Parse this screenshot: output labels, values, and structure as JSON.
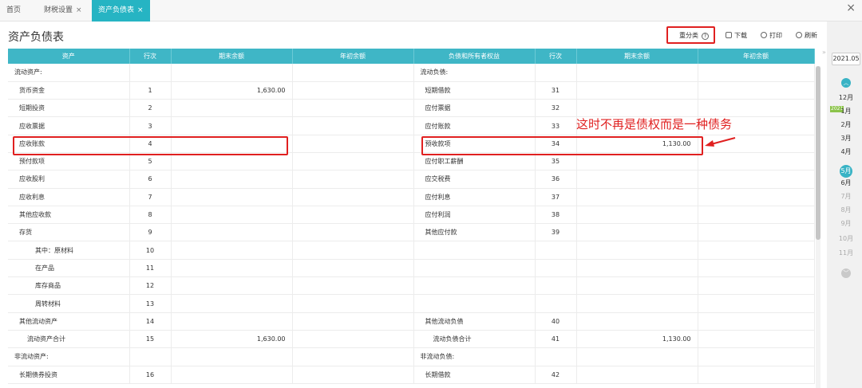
{
  "tabs": [
    {
      "label": "首页",
      "close": ""
    },
    {
      "label": "财税设置",
      "close": "×"
    },
    {
      "label": "资产负债表",
      "close": "×"
    }
  ],
  "window_close": "×",
  "page_title": "资产负债表",
  "toolbar": {
    "reclassify": "重分类",
    "help": "?",
    "download": "下载",
    "print": "打印",
    "refresh": "刷新"
  },
  "table": {
    "headers": [
      "资产",
      "行次",
      "期末余额",
      "年初余额",
      "负债和所有者权益",
      "行次",
      "期末余额",
      "年初余额"
    ],
    "rows": [
      {
        "a": "流动资产:",
        "an": "",
        "ae": "",
        "ab": "",
        "l": "流动负债:",
        "ln": "",
        "le": "",
        "lb": ""
      },
      {
        "a": "货币资金",
        "an": "1",
        "ae": "1,630.00",
        "ab": "",
        "l": "短期借款",
        "ln": "31",
        "le": "",
        "lb": ""
      },
      {
        "a": "短期投资",
        "an": "2",
        "ae": "",
        "ab": "",
        "l": "应付票据",
        "ln": "32",
        "le": "",
        "lb": ""
      },
      {
        "a": "应收票据",
        "an": "3",
        "ae": "",
        "ab": "",
        "l": "应付账款",
        "ln": "33",
        "le": "",
        "lb": ""
      },
      {
        "a": "应收账款",
        "an": "4",
        "ae": "",
        "ab": "",
        "l": "预收款项",
        "ln": "34",
        "le": "1,130.00",
        "lb": ""
      },
      {
        "a": "预付款项",
        "an": "5",
        "ae": "",
        "ab": "",
        "l": "应付职工薪酬",
        "ln": "35",
        "le": "",
        "lb": ""
      },
      {
        "a": "应收股利",
        "an": "6",
        "ae": "",
        "ab": "",
        "l": "应交税费",
        "ln": "36",
        "le": "",
        "lb": ""
      },
      {
        "a": "应收利息",
        "an": "7",
        "ae": "",
        "ab": "",
        "l": "应付利息",
        "ln": "37",
        "le": "",
        "lb": ""
      },
      {
        "a": "其他应收款",
        "an": "8",
        "ae": "",
        "ab": "",
        "l": "应付利润",
        "ln": "38",
        "le": "",
        "lb": ""
      },
      {
        "a": "存货",
        "an": "9",
        "ae": "",
        "ab": "",
        "l": "其他应付款",
        "ln": "39",
        "le": "",
        "lb": ""
      },
      {
        "a": "其中：原材料",
        "an": "10",
        "ae": "",
        "ab": "",
        "l": "",
        "ln": "",
        "le": "",
        "lb": ""
      },
      {
        "a": "在产品",
        "an": "11",
        "ae": "",
        "ab": "",
        "l": "",
        "ln": "",
        "le": "",
        "lb": ""
      },
      {
        "a": "库存商品",
        "an": "12",
        "ae": "",
        "ab": "",
        "l": "",
        "ln": "",
        "le": "",
        "lb": ""
      },
      {
        "a": "周转材料",
        "an": "13",
        "ae": "",
        "ab": "",
        "l": "",
        "ln": "",
        "le": "",
        "lb": ""
      },
      {
        "a": "其他流动资产",
        "an": "14",
        "ae": "",
        "ab": "",
        "l": "其他流动负债",
        "ln": "40",
        "le": "",
        "lb": ""
      },
      {
        "a": "流动资产合计",
        "an": "15",
        "ae": "1,630.00",
        "ab": "",
        "l": "流动负债合计",
        "ln": "41",
        "le": "1,130.00",
        "lb": ""
      },
      {
        "a": "非流动资产:",
        "an": "",
        "ae": "",
        "ab": "",
        "l": "非流动负债:",
        "ln": "",
        "le": "",
        "lb": ""
      },
      {
        "a": "长期债券投资",
        "an": "16",
        "ae": "",
        "ab": "",
        "l": "长期借款",
        "ln": "42",
        "le": "",
        "lb": ""
      }
    ]
  },
  "datebar": {
    "year": "2021.05",
    "year_flag": "2021",
    "months": [
      "12月",
      "1月",
      "2月",
      "3月",
      "4月",
      "5月",
      "6月",
      "7月",
      "8月",
      "9月",
      "10月",
      "11月"
    ],
    "selected": "5月"
  },
  "annotation": {
    "text": "这时不再是债权而是一种债务",
    "color": "#e02020"
  },
  "colors": {
    "accent": "#26b4c3",
    "header": "#3fb6c6"
  }
}
